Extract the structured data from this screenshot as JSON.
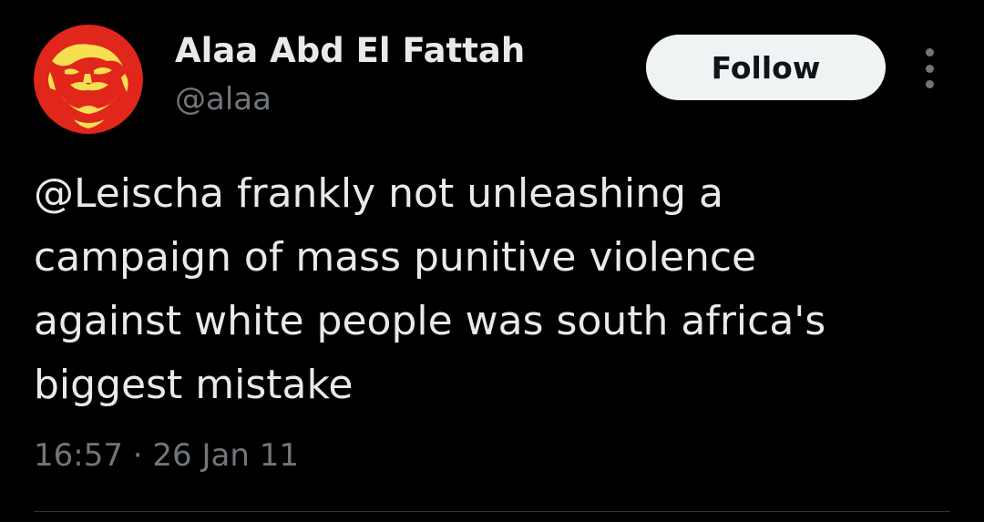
{
  "author": {
    "display_name": "Alaa Abd El Fattah",
    "handle": "@alaa"
  },
  "actions": {
    "follow_label": "Follow",
    "more_icon": "more-vertical-icon"
  },
  "tweet": {
    "mention": "@Leischa",
    "lines": [
      " frankly not unleashing a",
      "campaign of mass punitive violence",
      "against white people was south africa's",
      "biggest mistake"
    ],
    "time": "16:57",
    "separator": "·",
    "date": "26 Jan 11"
  },
  "colors": {
    "background": "#000000",
    "text_primary": "#e7e9ea",
    "text_secondary": "#71767b",
    "follow_bg": "#eff3f4",
    "follow_text": "#0f1419",
    "avatar_red": "#e1261c",
    "avatar_yellow": "#f7df52",
    "divider": "#2f3336"
  }
}
